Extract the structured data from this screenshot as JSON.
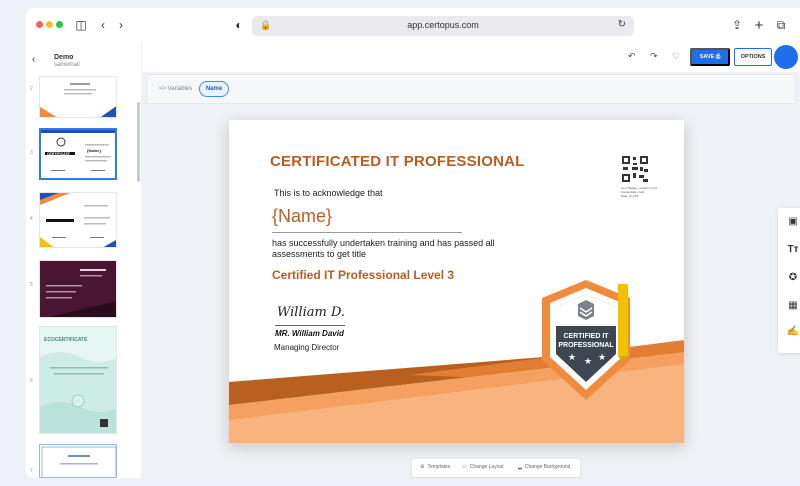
{
  "browser": {
    "url": "app.certopus.com",
    "traffic_colors": [
      "#ff5f57",
      "#febc2e",
      "#28c840"
    ]
  },
  "left_panel": {
    "project_name": "Demo",
    "project_sub": "samemail",
    "thumbnail_numbers": [
      "2",
      "3",
      "4",
      "5",
      "6",
      "7"
    ],
    "thumb1_texts": {
      "name": "{Name}",
      "cert": "CERTIFICATE"
    },
    "thumb5_title": "ECOCERTIFICATE"
  },
  "toolbar": {
    "save_label": "SAVE",
    "options_label": "OPTIONS"
  },
  "variables": {
    "label": "<> Variables",
    "chip": "Name"
  },
  "certificate": {
    "title": "CERTIFICATED IT PROFESSIONAL",
    "ack": "This is to acknowledge that",
    "name": "{Name}",
    "body": "has successfully undertaken training and has passed all assessments to get title",
    "course": "Certified IT Professional Level 3",
    "signature": "William D.",
    "signer": "MR. William David",
    "role": "Managing Director",
    "badge_line1": "CERTIFIED IT",
    "badge_line2": "PROFESSIONAL",
    "qr_caption": "Cert. Badge_number | Cert. Credentials | Cert. Date_of_birth",
    "colors": {
      "accent": "#b85d22",
      "orange": "#f08a3c",
      "light_orange": "#f7a86a",
      "badge_dark": "#3e4751"
    }
  },
  "bottom_tools": {
    "templates": "Templates",
    "change_layout": "Change Layout",
    "change_background": "Change Background"
  }
}
